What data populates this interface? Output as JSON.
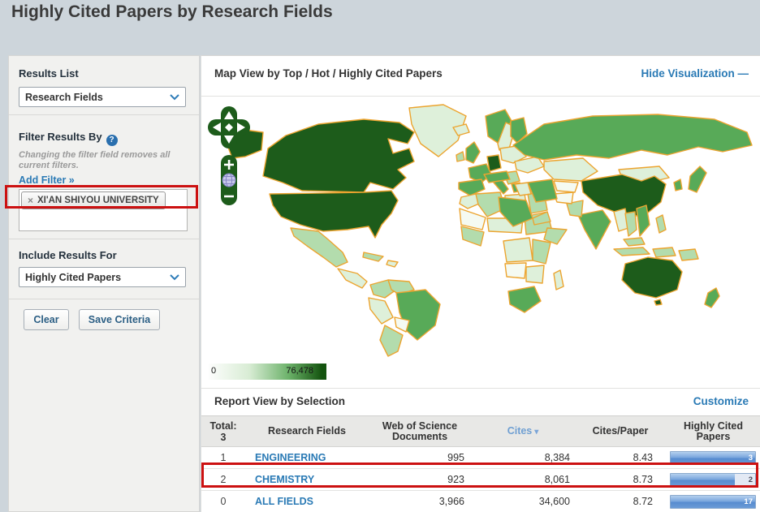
{
  "page": {
    "title": "Highly Cited Papers by Research Fields"
  },
  "sidebar": {
    "results_list": {
      "label": "Results List",
      "selected": "Research Fields"
    },
    "filter": {
      "header": "Filter Results By",
      "help_icon": "?",
      "note": "Changing the filter field removes all current filters.",
      "add_filter_label": "Add Filter »",
      "tag": {
        "remove_icon": "×",
        "label": "XI'AN SHIYOU UNIVERSITY"
      }
    },
    "include": {
      "label": "Include Results For",
      "selected": "Highly Cited Papers"
    },
    "buttons": {
      "clear": "Clear",
      "save": "Save Criteria"
    }
  },
  "map_view": {
    "header": "Map View by Top / Hot / Highly Cited Papers",
    "hide_link": "Hide Visualization",
    "collapse_icon": "—",
    "zoom_in": "+",
    "zoom_out": "−",
    "legend": {
      "min": "0",
      "max": "76,478"
    },
    "palette": [
      "#f5faf2",
      "#def0da",
      "#b3dcad",
      "#58aa58",
      "#1d5c1b"
    ],
    "border_color": "#eca42f",
    "regions": {
      "alaska": 4,
      "canada": 4,
      "greenland": 1,
      "usa": 4,
      "mexico": 2,
      "central-america": 1,
      "cuba": 2,
      "hispaniola": 1,
      "colombia": 2,
      "venezuela": 2,
      "peru": 1,
      "brazil": 3,
      "bolivia": 0,
      "argentina": 2,
      "iceland": 1,
      "ireland": 2,
      "uk": 3,
      "norway": 3,
      "sweden": 1,
      "finland": 3,
      "germany": 4,
      "france": 3,
      "spain": 3,
      "italy": 3,
      "poland": 1,
      "ukraine": 1,
      "balkans": 2,
      "greece": 3,
      "morocco": 1,
      "algeria": 2,
      "libya": 1,
      "egypt": 2,
      "mauritania": 0,
      "sahel": 1,
      "sudan": 2,
      "west-africa": 2,
      "horn-of-africa": 2,
      "drc": 1,
      "east-africa": 2,
      "angola": 0,
      "zambia": 1,
      "south-africa": 3,
      "madagascar": 1,
      "russia": 3,
      "kazakhstan": 1,
      "central-asia": 0,
      "mongolia": 1,
      "china": 4,
      "india": 3,
      "pakistan": 2,
      "afghanistan": 0,
      "iran": 3,
      "iraq": 1,
      "turkey": 3,
      "saudi-arabia": 3,
      "yemen-oman": 2,
      "myanmar": 1,
      "thailand": 2,
      "vietnam": 3,
      "malaysia": 2,
      "indonesia-west": 2,
      "indonesia-east": 2,
      "papua-new-guinea": 2,
      "philippines": 2,
      "south-korea": 3,
      "japan": 3,
      "australia": 4,
      "tasmania": 4,
      "new-zealand": 3
    }
  },
  "report": {
    "header": "Report View by Selection",
    "customize": "Customize",
    "table": {
      "total_label": "Total:",
      "total_value": "3",
      "headers": {
        "fields": "Research Fields",
        "docs": "Web of Science Documents",
        "cites": "Cites",
        "sort_icon": "▾",
        "cpp": "Cites/Paper",
        "hcp": "Highly Cited Papers"
      },
      "rows": [
        {
          "rank": "1",
          "field": "ENGINEERING",
          "docs": "995",
          "cites": "8,384",
          "cpp": "8.43",
          "hcp": "3",
          "bar_width": "100%"
        },
        {
          "rank": "2",
          "field": "CHEMISTRY",
          "docs": "923",
          "cites": "8,061",
          "cpp": "8.73",
          "hcp": "2",
          "bar_width": "76%"
        },
        {
          "rank": "0",
          "field": "ALL FIELDS",
          "docs": "3,966",
          "cites": "34,600",
          "cpp": "8.72",
          "hcp": "17",
          "bar_width": "100%"
        }
      ]
    }
  },
  "annotations": {
    "highlight_color": "#cc1111"
  }
}
